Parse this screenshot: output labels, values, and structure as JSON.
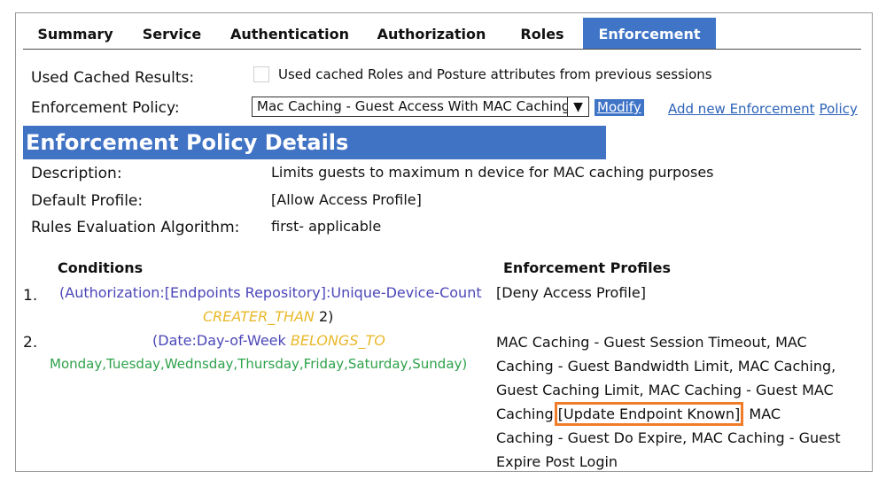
{
  "tabs": [
    {
      "label": "Summary",
      "active": false
    },
    {
      "label": "Service",
      "active": false
    },
    {
      "label": "Authentication",
      "active": false
    },
    {
      "label": "Authorization",
      "active": false
    },
    {
      "label": "Roles",
      "active": false
    },
    {
      "label": "Enforcement",
      "active": true
    }
  ],
  "cached_results": {
    "label": "Used Cached Results:",
    "checkbox_label": "Used cached Roles and Posture attributes from previous sessions",
    "checked": false
  },
  "enforcement_policy": {
    "label": "Enforcement Policy:",
    "selected": "Mac Caching - Guest Access With MAC Caching",
    "modify_label": "Modify",
    "add_link_part1": "Add new Enforcement",
    "add_link_part2": "Policy"
  },
  "details": {
    "title": "Enforcement Policy Details",
    "description_label": "Description:",
    "description_value": "Limits guests to maximum n device for MAC caching purposes",
    "default_profile_label": "Default Profile:",
    "default_profile_value": "[Allow Access Profile]",
    "algorithm_label": "Rules Evaluation Algorithm:",
    "algorithm_value": "first- applicable"
  },
  "rules": {
    "conditions_header": "Conditions",
    "profiles_header": "Enforcement Profiles",
    "rows": [
      {
        "number": "1.",
        "condition_main": "(Authorization:[Endpoints Repository]:Unique-Device-Count",
        "condition_operator": "CREATER_THAN",
        "condition_value": " 2)",
        "profiles": "[Deny Access Profile]"
      },
      {
        "number": "2.",
        "condition_main": "(Date:Day-of-Week ",
        "condition_operator": "BELONGS_TO",
        "condition_value": "Monday,Tuesday,Wednsday,Thursday,Friday,Saturday,Sunday)",
        "profiles_before": "MAC Caching - Guest Session Timeout, MAC Caching - Guest Bandwidth Limit, MAC Caching, Guest Caching Limit, MAC Caching - Guest MAC Caching ",
        "profiles_highlight": "[Update Endpoint Known]",
        "profiles_after": ", MAC Caching - Guest Do Expire, MAC Caching - Guest Expire Post Login"
      }
    ]
  },
  "colors": {
    "accent": "#3f74c7",
    "condition_blue": "#4b47b8",
    "operator_gold": "#e8b92b",
    "value_green": "#2da24a",
    "highlight_orange": "#f07c2a"
  }
}
